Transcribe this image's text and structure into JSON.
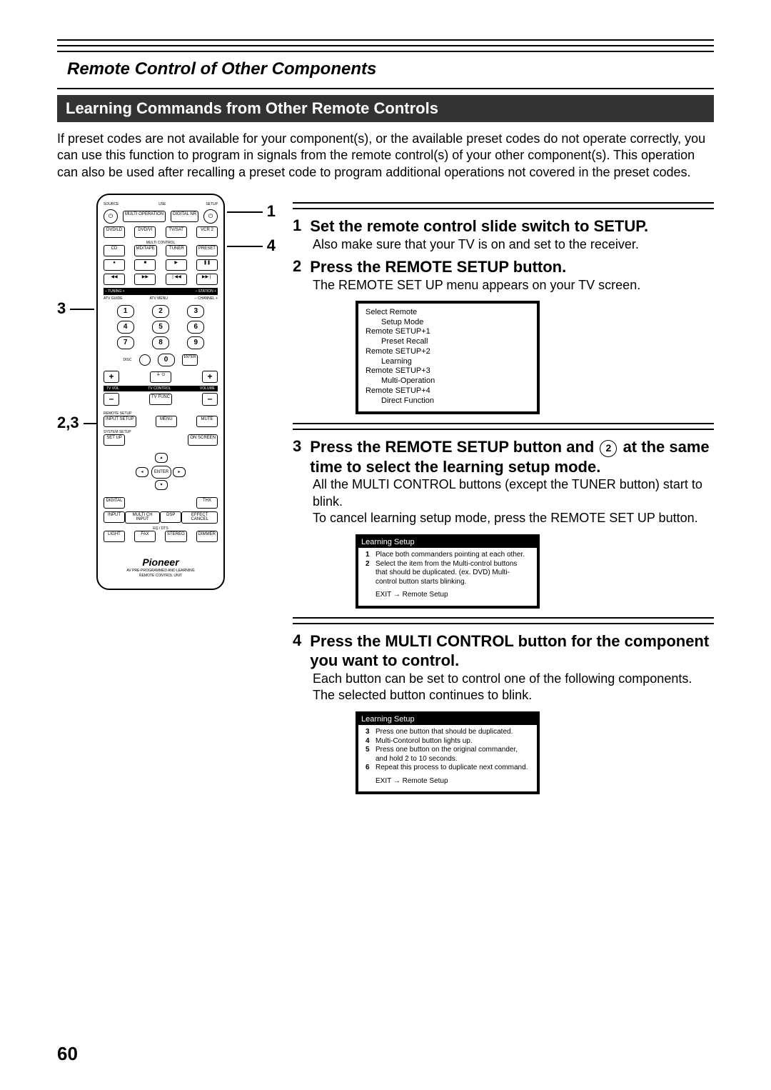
{
  "page_number": "60",
  "header_title": "Remote Control of Other Components",
  "section_title": "Learning Commands from Other Remote Controls",
  "intro": "If preset codes are not available for your component(s), or the available preset codes do not operate correctly, you can use this function to program in signals from the remote control(s) of your other component(s). This operation can also be used after recalling a preset code to program additional operations not covered in the preset codes.",
  "callouts": {
    "top_right_1": "1",
    "top_right_4": "4",
    "left_3": "3",
    "left_23": "2,3"
  },
  "remote": {
    "top_labels": [
      "SOURCE",
      "",
      "USE",
      "SETUP"
    ],
    "row_power": [
      "MULTI OPERATION",
      "DIGITAL NR"
    ],
    "multi_control_label": "MULTI CONTROL",
    "row_mc1": [
      "DVD/LD",
      "DVD/VI",
      "TV/SAT",
      "VCR 2"
    ],
    "row_mc2": [
      "CD",
      "MD/TAPE",
      "TUNER",
      "PRESET"
    ],
    "playback_block": [
      "●",
      "■",
      "▶",
      "❚❚",
      "◀◀",
      "▶▶",
      "❘◀◀",
      "▶▶❘"
    ],
    "tuning_labels": [
      "–  TUNING  +",
      "–  STATION  +"
    ],
    "menu_labels": [
      "ATV GUIDE",
      "ATV MENU",
      "–  CHANNEL  +"
    ],
    "numbers": [
      "1",
      "2",
      "3",
      "4",
      "5",
      "6",
      "7",
      "8",
      "9"
    ],
    "zero": "0",
    "side_labels_left": "DISC",
    "side_labels_right": "ENTER",
    "row_vol_labels": [
      "TV VOL",
      "TV CONTROL",
      "VOLUME"
    ],
    "row_tvfunc": "TV FUNC",
    "remote_setup_label": "REMOTE SETUP",
    "row_setup": [
      "INPUT SETUP",
      "",
      "MENU",
      "MUTE"
    ],
    "system_setup_label": "SYSTEM SETUP",
    "row_sys": [
      "SET UP",
      "",
      "ON SCREEN"
    ],
    "enter": "ENTER",
    "row_thx": [
      "DIGITAL",
      "",
      "THX"
    ],
    "row_input": [
      "INPUT",
      "MULTI CH INPUT",
      "DSP",
      "EFFECT CANCEL"
    ],
    "eq_label": "   EQ   /  DTS",
    "row_bottom": [
      "LIGHT",
      "FAX",
      "STEREO",
      "DIMMER"
    ],
    "brand": "Pioneer",
    "brand_sub1": "AV PRE-PROGRAMMED AND LEARNING",
    "brand_sub2": "REMOTE CONTROL UNIT"
  },
  "steps": [
    {
      "num": "1",
      "title_parts": [
        "Set the remote control slide switch to SETUP."
      ],
      "body": [
        {
          "type": "text",
          "text": "Also make sure that your TV is on and set to the receiver."
        }
      ]
    },
    {
      "num": "2",
      "title_parts": [
        "Press the REMOTE SETUP button."
      ],
      "body": [
        {
          "type": "text",
          "text": "The REMOTE SET UP menu appears on your TV screen."
        }
      ],
      "osd": {
        "title": "Select Remote",
        "subtitle": "Setup Mode",
        "items": [
          {
            "main": "Remote SETUP+1",
            "sub": "Preset Recall"
          },
          {
            "main": "Remote SETUP+2",
            "sub": "Learning"
          },
          {
            "main": "Remote SETUP+3",
            "sub": "Multi-Operation"
          },
          {
            "main": "Remote SETUP+4",
            "sub": "Direct Function"
          }
        ]
      }
    },
    {
      "num": "3",
      "title_parts": [
        "Press the REMOTE SETUP button and ",
        "2",
        " at the same time to select the learning setup mode."
      ],
      "body": [
        {
          "type": "text",
          "text": "All the MULTI CONTROL buttons (except the TUNER button) start to blink."
        },
        {
          "type": "bold",
          "text": "To cancel learning setup mode, press the REMOTE SET UP button."
        }
      ],
      "osd": {
        "black_title": "Learning Setup",
        "numbered": [
          {
            "n": "1",
            "t": "Place both commanders pointing at each other."
          },
          {
            "n": "2",
            "t": "Select the item from the Multi-control buttons that should be duplicated. (ex. DVD) Multi-control button starts blinking."
          }
        ],
        "exit": "EXIT → Remote Setup"
      }
    },
    {
      "num": "4",
      "title_parts": [
        "Press the MULTI CONTROL button for the component you want to control."
      ],
      "body": [
        {
          "type": "text",
          "text": "Each button can be set to control one of the following components."
        },
        {
          "type": "text",
          "text": "The selected button continues to blink."
        }
      ],
      "osd": {
        "black_title": "Learning Setup",
        "numbered": [
          {
            "n": "3",
            "t": "Press one button that should be duplicated."
          },
          {
            "n": "4",
            "t": "Multi-Contorol button lights up."
          },
          {
            "n": "5",
            "t": "Press one button on the original commander, and hold 2 to 10 seconds."
          },
          {
            "n": "6",
            "t": "Repeat this process to duplicate next command."
          }
        ],
        "exit": "EXIT → Remote Setup"
      }
    }
  ]
}
